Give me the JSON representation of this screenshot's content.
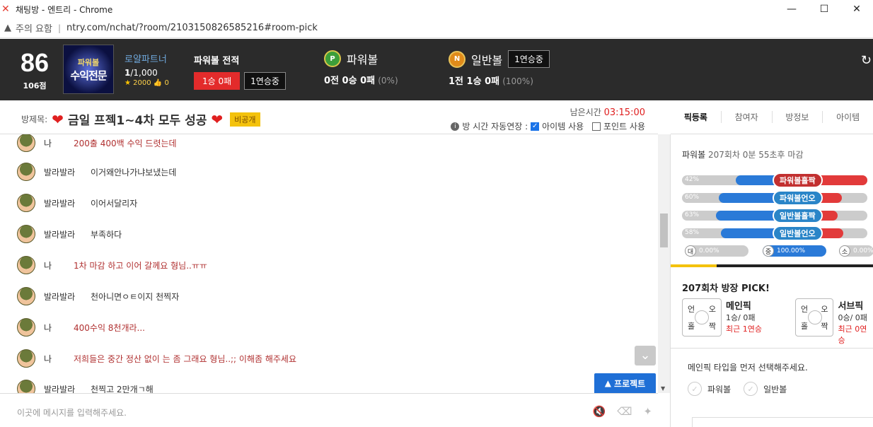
{
  "window": {
    "title": "채팅방 - 엔트리 - Chrome",
    "min": "—",
    "max": "☐",
    "close": "✕"
  },
  "address": {
    "warning": "주의 요함",
    "url": "ntry.com/nchat/?room/2103150826585216#room-pick"
  },
  "profile": {
    "score": "86",
    "points": "106점",
    "avatar_top": "파워볼",
    "avatar_main": "수익전문",
    "name": "로얄파트너",
    "rank_num": "1",
    "rank_total": "/1,000",
    "stars": "2000",
    "likes": "0"
  },
  "powerball_record": {
    "label": "파워볼 전적",
    "record": "1승 0패",
    "streak": "1연승중"
  },
  "games": [
    {
      "icon": "P",
      "name": "파워볼",
      "result": "0전 0승 0패",
      "pct": "(0%)",
      "streak": ""
    },
    {
      "icon": "N",
      "name": "일반볼",
      "result": "1전 1승 0패",
      "pct": "(100%)",
      "streak": "1연승중"
    }
  ],
  "room": {
    "label": "방제목:",
    "title": "금일 프젝1~4차 모두 성공",
    "private": "비공개",
    "timer_label": "남은시간",
    "timer": "03:15:00",
    "auto_extend": "방 시간 자동연장 :",
    "item_use": "아이템 사용",
    "point_use": "포인트 사용"
  },
  "tabs": [
    "픽등록",
    "참여자",
    "방정보",
    "아이템"
  ],
  "messages": [
    {
      "nick": "나",
      "text": "200출 400백 수익 드렷는데",
      "me": true
    },
    {
      "nick": "발라발라",
      "text": "이거왜안나가냐보냈는데",
      "me": false
    },
    {
      "nick": "발라발라",
      "text": "이어서달리자",
      "me": false
    },
    {
      "nick": "발라발라",
      "text": "부족하다",
      "me": false
    },
    {
      "nick": "나",
      "text": "1차 마감 하고 이어 갈께요 형님..ㅠㅠ",
      "me": true
    },
    {
      "nick": "발라발라",
      "text": "천아니면ㅇㅌ이지 천찍자",
      "me": false
    },
    {
      "nick": "나",
      "text": "400수익 8천개라...",
      "me": true
    },
    {
      "nick": "나",
      "text": "저희들은 중간 정산 없이 는 좀 그래요 형님..;; 이해좀 해주세요",
      "me": true
    },
    {
      "nick": "발라발라",
      "text": "천찍고 2만개ㄱ해",
      "me": false
    }
  ],
  "project_button": "프로젝트",
  "input_placeholder": "이곳에 메시지를 입력해주세요.",
  "side": {
    "title": "파워볼",
    "round_info": "207회차 0분 55초후 마감",
    "bars": [
      {
        "pct": "42%",
        "label": "파워볼홀짝",
        "color": "red"
      },
      {
        "pct": "60%",
        "label": "파워볼언오",
        "color": "blue"
      },
      {
        "pct": "63%",
        "label": "일반볼홀짝",
        "color": "blue"
      },
      {
        "pct": "58%",
        "label": "일반볼언오",
        "color": "blue"
      }
    ],
    "mini": [
      {
        "icon": "대",
        "pct": "0.00%"
      },
      {
        "icon": "중",
        "pct": "100.00%"
      },
      {
        "icon": "소",
        "pct": "0.00%"
      }
    ],
    "pick_title": "207회차 방장 PICK!",
    "picks": [
      {
        "title": "메인픽",
        "record": "1승/ 0패",
        "streak": "최근 1연승"
      },
      {
        "title": "서브픽",
        "record": "0승/ 0패",
        "streak": "최근 0연승"
      }
    ],
    "grid": [
      "언",
      "오",
      "홀",
      "짝"
    ],
    "prompt": "메인픽 타입을 먼저 선택해주세요.",
    "options": [
      "파워볼",
      "일반볼"
    ]
  }
}
